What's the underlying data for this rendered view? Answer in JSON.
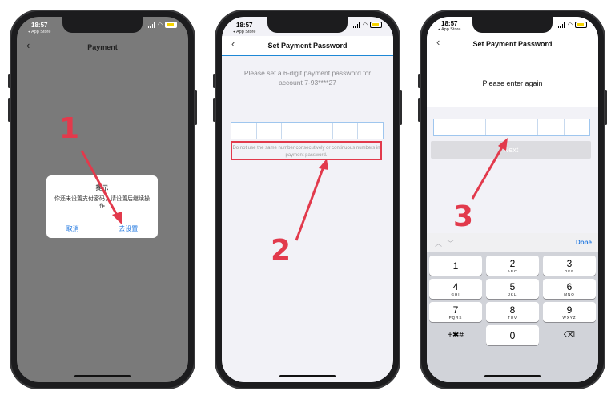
{
  "phone1": {
    "time": "18:57",
    "back_app": "◂ App Store",
    "nav_title": "Payment",
    "alert": {
      "title": "提示",
      "message": "你还未设置支付密码，请设置后继续操作",
      "cancel_label": "取消",
      "settings_label": "去设置"
    },
    "step_number": "1"
  },
  "phone2": {
    "time": "18:57",
    "back_app": "◂ App Store",
    "nav_title": "Set Payment Password",
    "instruction": "Please set a 6-digit payment password for account 7-93****27",
    "hint": "Do not use the same number consecutively or continuous numbers in payment password.",
    "step_number": "2"
  },
  "phone3": {
    "time": "18:57",
    "back_app": "◂ App Store",
    "nav_title": "Set Payment Password",
    "prompt": "Please enter again",
    "next_label": "Next",
    "done_label": "Done",
    "step_number": "3",
    "keys": [
      {
        "digit": "1",
        "letters": ""
      },
      {
        "digit": "2",
        "letters": "ABC"
      },
      {
        "digit": "3",
        "letters": "DEF"
      },
      {
        "digit": "4",
        "letters": "GHI"
      },
      {
        "digit": "5",
        "letters": "JKL"
      },
      {
        "digit": "6",
        "letters": "MNO"
      },
      {
        "digit": "7",
        "letters": "PQRS"
      },
      {
        "digit": "8",
        "letters": "TUV"
      },
      {
        "digit": "9",
        "letters": "WXYZ"
      },
      {
        "digit": "+✱#",
        "letters": ""
      },
      {
        "digit": "0",
        "letters": ""
      },
      {
        "digit": "⌫",
        "letters": ""
      }
    ]
  },
  "colors": {
    "annotation_red": "#e23a4c",
    "link_blue": "#2a7de1"
  }
}
